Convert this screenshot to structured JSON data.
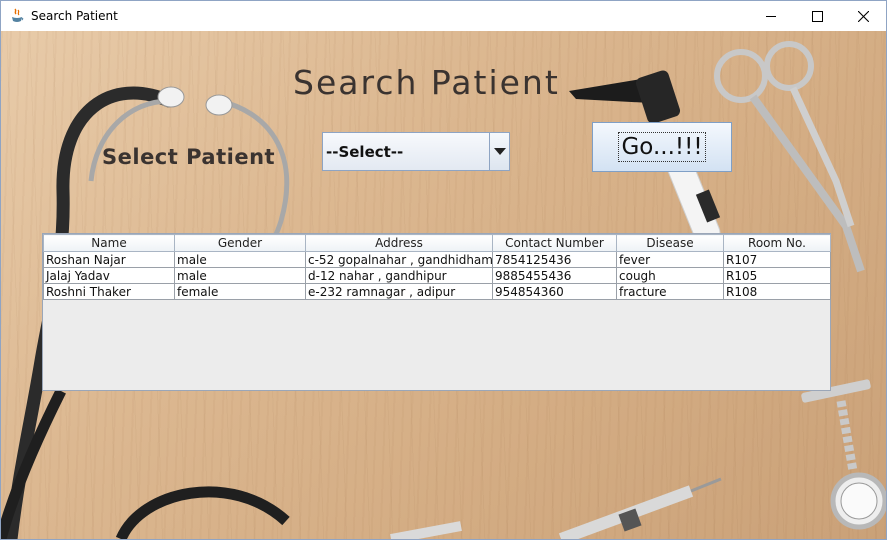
{
  "window": {
    "title": "Search Patient",
    "app_icon": "java-icon",
    "controls": [
      "minimize-icon",
      "maximize-icon",
      "close-icon"
    ]
  },
  "page": {
    "heading": "Search Patient",
    "select_label": "Select Patient",
    "combo": {
      "selected": "--Select--"
    },
    "go_button": "Go...!!!"
  },
  "table": {
    "columns": [
      "Name",
      "Gender",
      "Address",
      "Contact Number",
      "Disease",
      "Room No."
    ],
    "rows": [
      [
        "Roshan Najar",
        "male",
        "c-52 gopalnahar , gandhidham",
        "7854125436",
        "fever",
        "R107"
      ],
      [
        "Jalaj Yadav",
        "male",
        "d-12 nahar , gandhipur",
        "9885455436",
        "cough",
        "R105"
      ],
      [
        "Roshni Thaker",
        "female",
        "e-232 ramnagar , adipur",
        "954854360",
        "fracture",
        "R108"
      ]
    ]
  },
  "colors": {
    "title_text": "#3a3330",
    "window_border": "#8fa4c4",
    "table_bg": "#ececec",
    "button_gradient_bottom": "#d3e2f3"
  }
}
